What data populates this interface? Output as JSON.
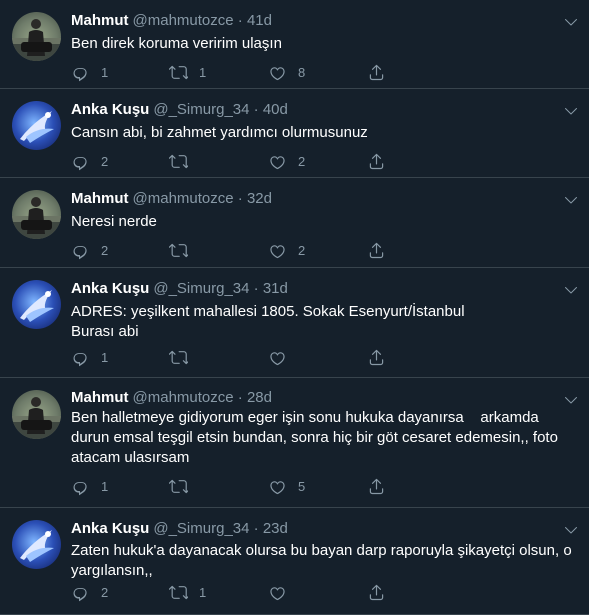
{
  "tweets": [
    {
      "name": "Mahmut",
      "handle": "@mahmutozce",
      "time": "41d",
      "text": "Ben direk koruma veririm ulaşın",
      "replies": "1",
      "retweets": "1",
      "likes": "8"
    },
    {
      "name": "Anka Kuşu",
      "handle": "@_Simurg_34",
      "time": "40d",
      "text": "Cansın abi, bi zahmet yardımcı olurmusunuz",
      "replies": "2",
      "retweets": "",
      "likes": "2"
    },
    {
      "name": "Mahmut",
      "handle": "@mahmutozce",
      "time": "32d",
      "text": "Neresi nerde",
      "replies": "2",
      "retweets": "",
      "likes": "2"
    },
    {
      "name": "Anka Kuşu",
      "handle": "@_Simurg_34",
      "time": "31d",
      "text": "ADRES: yeşilkent mahallesi 1805. Sokak Esenyurt/İstanbul\nBurası abi",
      "replies": "1",
      "retweets": "",
      "likes": ""
    },
    {
      "name": "Mahmut",
      "handle": "@mahmutozce",
      "time": "28d",
      "text": "Ben halletmeye gidiyorum eger işin sonu hukuka dayanırsa    arkamda durun emsal teşgil etsin bundan, sonra hiç bir göt cesaret edemesin,, foto atacam ulasırsam",
      "replies": "1",
      "retweets": "",
      "likes": "5"
    },
    {
      "name": "Anka Kuşu",
      "handle": "@_Simurg_34",
      "time": "23d",
      "text": "Zaten hukuk'a dayanacak olursa bu bayan darp raporuyla şikayetçi olsun, o yargılansın,,",
      "replies": "2",
      "retweets": "1",
      "likes": ""
    }
  ],
  "separator": "·",
  "icons": {
    "reply": "reply-icon",
    "retweet": "retweet-icon",
    "like": "like-icon",
    "share": "share-icon",
    "more": "chevron-down-icon"
  },
  "colors": {
    "background": "#15202b",
    "muted": "#8899a6",
    "border": "#38444d",
    "text": "#ffffff"
  }
}
